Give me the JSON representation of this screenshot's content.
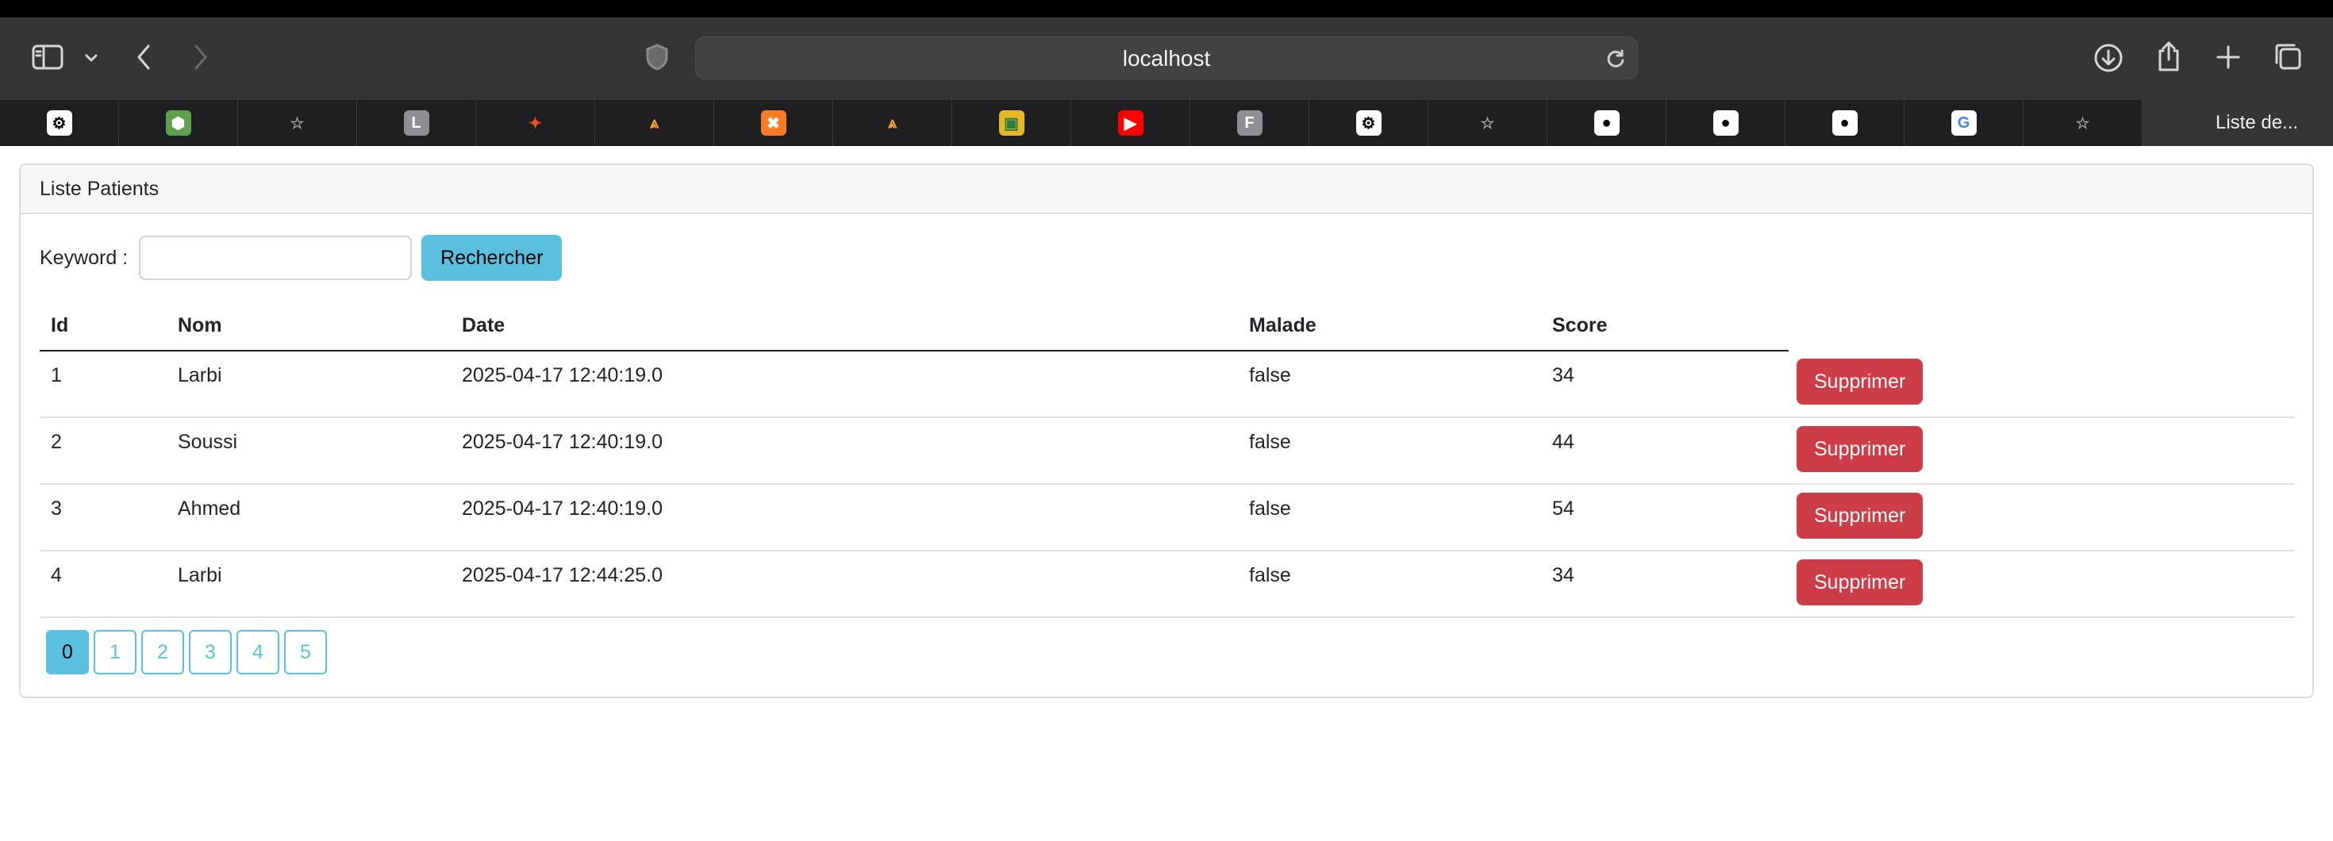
{
  "browser": {
    "url": "localhost",
    "active_tab": "Liste de...",
    "tab_favicons": [
      {
        "icon": "openai-icon",
        "bg": "#ffffff",
        "fg": "#000000",
        "glyph": "⚙"
      },
      {
        "icon": "nodejs-icon",
        "bg": "#5fa04e",
        "fg": "#ffffff",
        "glyph": "⬢"
      },
      {
        "icon": "bookmark-star-icon",
        "bg": "transparent",
        "fg": "#a0a0a0",
        "glyph": "☆"
      },
      {
        "icon": "letter-l-icon",
        "bg": "#8e8e93",
        "fg": "#ffffff",
        "glyph": "L"
      },
      {
        "icon": "figma-icon",
        "bg": "transparent",
        "fg": "#f24e1e",
        "glyph": "✦"
      },
      {
        "icon": "fmr-icon",
        "bg": "transparent",
        "fg": "#f0a030",
        "glyph": "⩓"
      },
      {
        "icon": "xampp-icon",
        "bg": "#fb7a24",
        "fg": "#ffffff",
        "glyph": "✖"
      },
      {
        "icon": "fmr-icon",
        "bg": "transparent",
        "fg": "#f0a030",
        "glyph": "⩓"
      },
      {
        "icon": "contacts-icon",
        "bg": "#e5b825",
        "fg": "#2d7a3f",
        "glyph": "▣"
      },
      {
        "icon": "youtube-icon",
        "bg": "#ff0000",
        "fg": "#ffffff",
        "glyph": "▶"
      },
      {
        "icon": "letter-f-icon",
        "bg": "#8e8e93",
        "fg": "#ffffff",
        "glyph": "F"
      },
      {
        "icon": "openai-icon",
        "bg": "#ffffff",
        "fg": "#000000",
        "glyph": "⚙"
      },
      {
        "icon": "bookmark-star-icon",
        "bg": "transparent",
        "fg": "#a0a0a0",
        "glyph": "☆"
      },
      {
        "icon": "github-icon",
        "bg": "#ffffff",
        "fg": "#000000",
        "glyph": "●"
      },
      {
        "icon": "github-icon",
        "bg": "#ffffff",
        "fg": "#000000",
        "glyph": "●"
      },
      {
        "icon": "github-icon",
        "bg": "#ffffff",
        "fg": "#000000",
        "glyph": "●"
      },
      {
        "icon": "google-icon",
        "bg": "#ffffff",
        "fg": "#4285f4",
        "glyph": "G"
      },
      {
        "icon": "bookmark-star-icon",
        "bg": "transparent",
        "fg": "#a0a0a0",
        "glyph": "☆"
      }
    ]
  },
  "card": {
    "title": "Liste Patients"
  },
  "search": {
    "label": "Keyword :",
    "value": "",
    "button": "Rechercher"
  },
  "table": {
    "headers": [
      "Id",
      "Nom",
      "Date",
      "Malade",
      "Score"
    ],
    "rows": [
      {
        "id": "1",
        "nom": "Larbi",
        "date": "2025-04-17 12:40:19.0",
        "malade": "false",
        "score": "34",
        "action": "Supprimer"
      },
      {
        "id": "2",
        "nom": "Soussi",
        "date": "2025-04-17 12:40:19.0",
        "malade": "false",
        "score": "44",
        "action": "Supprimer"
      },
      {
        "id": "3",
        "nom": "Ahmed",
        "date": "2025-04-17 12:40:19.0",
        "malade": "false",
        "score": "54",
        "action": "Supprimer"
      },
      {
        "id": "4",
        "nom": "Larbi",
        "date": "2025-04-17 12:44:25.0",
        "malade": "false",
        "score": "34",
        "action": "Supprimer"
      }
    ]
  },
  "pagination": {
    "pages": [
      "0",
      "1",
      "2",
      "3",
      "4",
      "5"
    ],
    "current": "0"
  },
  "colors": {
    "info": "#5bc0de",
    "danger": "#cc3d47"
  }
}
